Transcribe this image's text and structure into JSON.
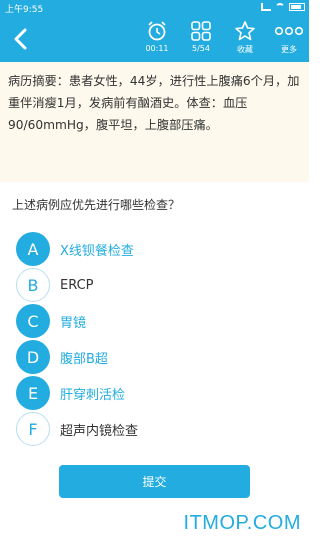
{
  "status_bar": {
    "time": "上午9:55"
  },
  "toolbar": {
    "timer_label": "00:11",
    "progress_label": "5/54",
    "favorite_label": "收藏",
    "more_label": "更多"
  },
  "question": {
    "stem": "病历摘要：患者女性，44岁，进行性上腹痛6个月，加重伴消瘦1月，发病前有酗酒史。体查：血压90/60mmHg，腹平坦，上腹部压痛。",
    "prompt": "上述病例应优先进行哪些检查？",
    "options": [
      {
        "letter": "A",
        "text": "X线钡餐检查",
        "selected": true
      },
      {
        "letter": "B",
        "text": "ERCP",
        "selected": false
      },
      {
        "letter": "C",
        "text": "胃镜",
        "selected": true
      },
      {
        "letter": "D",
        "text": "腹部B超",
        "selected": true
      },
      {
        "letter": "E",
        "text": "肝穿刺活检",
        "selected": true
      },
      {
        "letter": "F",
        "text": "超声内镜检查",
        "selected": false
      }
    ]
  },
  "submit_label": "提交",
  "watermark": "ITMOP.COM",
  "colors": {
    "accent": "#23ace0",
    "stem_background": "#fdf9ec"
  }
}
